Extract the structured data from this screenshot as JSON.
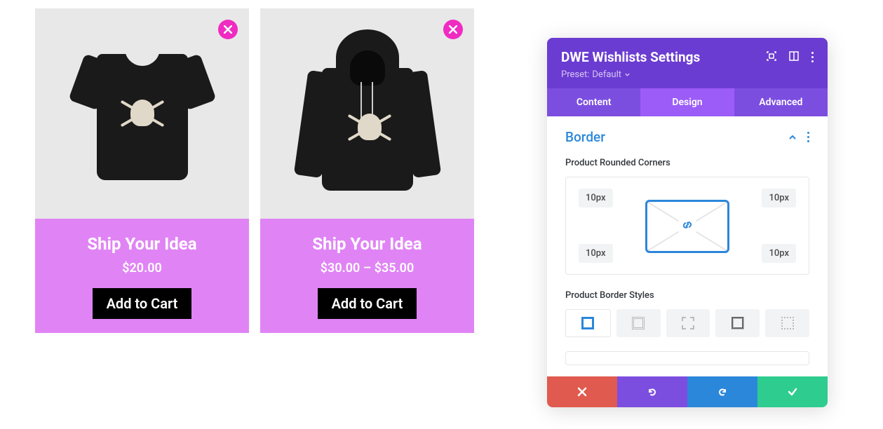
{
  "products": [
    {
      "title": "Ship Your Idea",
      "price": "$20.00",
      "cta": "Add to Cart"
    },
    {
      "title": "Ship Your Idea",
      "price": "$30.00 – $35.00",
      "cta": "Add to Cart"
    }
  ],
  "panel": {
    "title": "DWE Wishlists Settings",
    "preset_label": "Preset:",
    "preset_value": "Default",
    "tabs": {
      "content": "Content",
      "design": "Design",
      "advanced": "Advanced"
    },
    "section": {
      "title": "Border"
    },
    "fields": {
      "rounded_label": "Product Rounded Corners",
      "corners": {
        "tl": "10px",
        "tr": "10px",
        "bl": "10px",
        "br": "10px"
      },
      "border_styles_label": "Product Border Styles"
    }
  },
  "colors": {
    "accent_purple": "#7c4ee0",
    "accent_pink": "#e084f5",
    "accent_blue": "#2b87da"
  }
}
